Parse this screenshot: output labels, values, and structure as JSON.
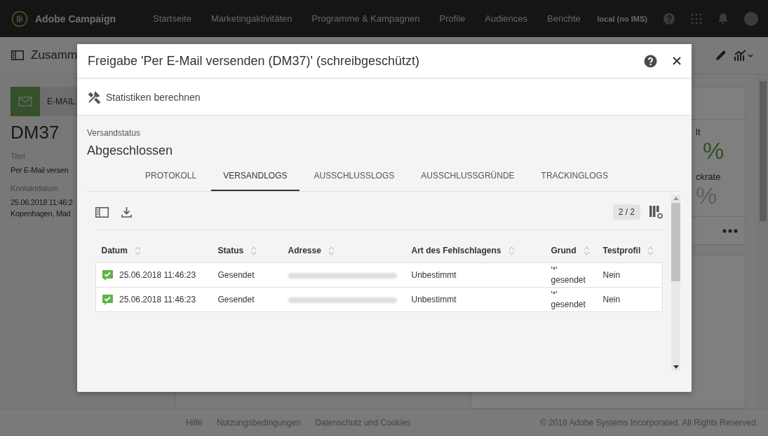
{
  "nav": {
    "brand": "Adobe Campaign",
    "items": [
      "Startseite",
      "Marketingaktivitäten",
      "Programme & Kampagnen",
      "Profile",
      "Audiences",
      "Berichte"
    ],
    "instance": "local (no IMS)"
  },
  "page": {
    "title": "Zusamm",
    "channel": "E-MAIL",
    "name": "DM37",
    "fields": [
      {
        "label": "Titel",
        "values": [
          "Per E-Mail versen"
        ]
      },
      {
        "label": "Kontaktdatum",
        "values": [
          "25.06.2018 11:46:2",
          "Kopenhagen, Mad"
        ]
      }
    ],
    "kpis": [
      {
        "label": "lt",
        "value": "%",
        "kind": "positive"
      },
      {
        "label": "ckrate",
        "value": "%",
        "kind": "neutral"
      }
    ]
  },
  "dialog": {
    "title": "Freigabe 'Per E-Mail versenden (DM37)' (schreibgeschützt)",
    "action": "Statistiken berechnen",
    "status_label": "Versandstatus",
    "status": "Abgeschlossen",
    "tabs": [
      {
        "label": "PROTOKOLL",
        "selected": false
      },
      {
        "label": "VERSANDLOGS",
        "selected": true
      },
      {
        "label": "AUSSCHLUSSLOGS",
        "selected": false
      },
      {
        "label": "AUSSCHLUSSGRÜNDE",
        "selected": false
      },
      {
        "label": "TRACKINGLOGS",
        "selected": false
      }
    ],
    "counter": "2 / 2",
    "table": {
      "columns": [
        "Datum",
        "Status",
        "Adresse",
        "Art des Fehlschlagens",
        "Grund",
        "Testprofil"
      ],
      "rows": [
        {
          "date": "25.06.2018 11:46:23",
          "status": "Gesendet",
          "failure_type": "Unbestimmt",
          "reason": "'*' gesendet",
          "test_profile": "Nein"
        },
        {
          "date": "25.06.2018 11:46:23",
          "status": "Gesendet",
          "failure_type": "Unbestimmt",
          "reason": "'*' gesendet",
          "test_profile": "Nein"
        }
      ]
    }
  },
  "footer": {
    "links": [
      "Hilfe",
      "Nutzungsbedingungen",
      "Datenschutz und Cookies"
    ],
    "copyright": "© 2018 Adobe Systems Incorporated. All Rights Reserved."
  }
}
